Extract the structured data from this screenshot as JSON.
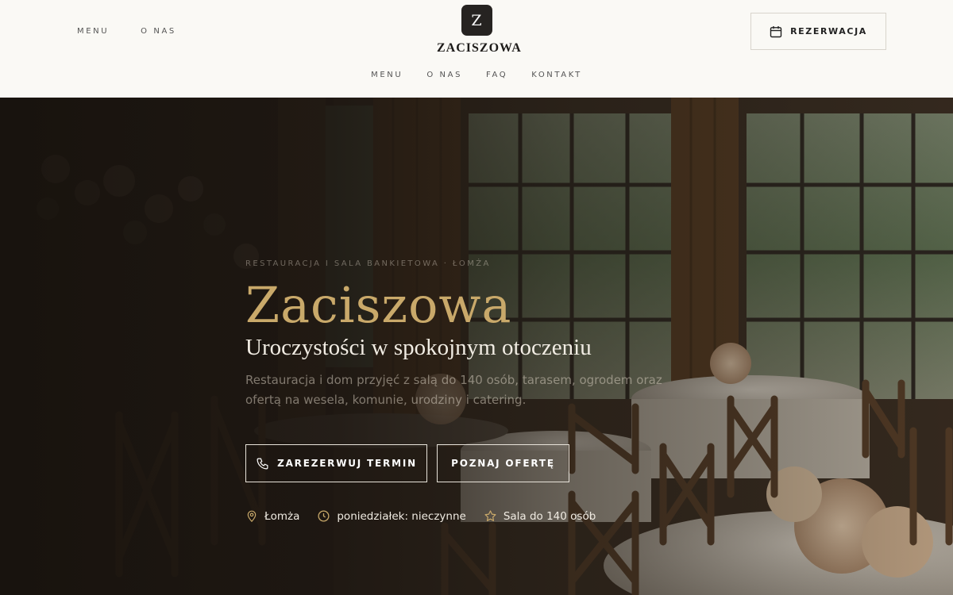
{
  "header": {
    "nav_top": [
      "MENU",
      "O NAS"
    ],
    "logo": {
      "mark": "Z",
      "name": "ZACISZOWA"
    },
    "reserve_label": "REZERWACJA",
    "nav_sub": [
      "MENU",
      "O NAS",
      "FAQ",
      "KONTAKT"
    ]
  },
  "hero": {
    "eyebrow": "RESTAURACJA I SALA BANKIETOWA · ŁOMŻA",
    "title": "Zaciszowa",
    "subtitle": "Uroczystości w spokojnym otoczeniu",
    "description": "Restauracja i dom przyjęć z salą do 140 osób, tarasem, ogrodem oraz ofertą na wesela, komunie, urodziny i catering.",
    "cta_primary": "ZAREZERWUJ TERMIN",
    "cta_secondary": "POZNAJ OFERTĘ",
    "info": [
      {
        "icon": "map-pin-icon",
        "text": "Łomża"
      },
      {
        "icon": "clock-icon",
        "text": "poniedziałek: nieczynne"
      },
      {
        "icon": "star-icon",
        "text": "Sala do 140 osób"
      }
    ]
  },
  "colors": {
    "accent_gold": "#c9a96a",
    "header_bg": "#faf9f5",
    "logo_bg": "#262321"
  }
}
